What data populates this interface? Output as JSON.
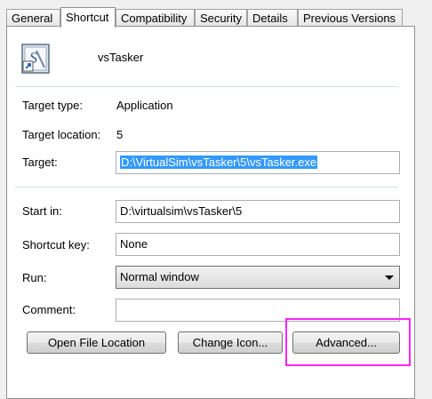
{
  "tabs": [
    "General",
    "Shortcut",
    "Compatibility",
    "Security",
    "Details",
    "Previous Versions"
  ],
  "shortcut": {
    "name": "vsTasker",
    "icon": "shortcut-app-icon",
    "target_type_label": "Target type:",
    "target_type_value": "Application",
    "target_location_label": "Target location:",
    "target_location_value": "5",
    "target_label": "Target:",
    "target_value": "D:\\VirtualSim\\vsTasker\\5\\vsTasker.exe",
    "start_in_label": "Start in:",
    "start_in_value": "D:\\virtualsim\\vsTasker\\5",
    "shortcut_key_label": "Shortcut key:",
    "shortcut_key_value": "None",
    "run_label": "Run:",
    "run_value": "Normal window",
    "comment_label": "Comment:",
    "comment_value": ""
  },
  "buttons": {
    "open_file_location": "Open File Location",
    "change_icon": "Change Icon...",
    "advanced": "Advanced..."
  },
  "colors": {
    "highlight": "#ff22ff",
    "selection": "#3399ff"
  }
}
